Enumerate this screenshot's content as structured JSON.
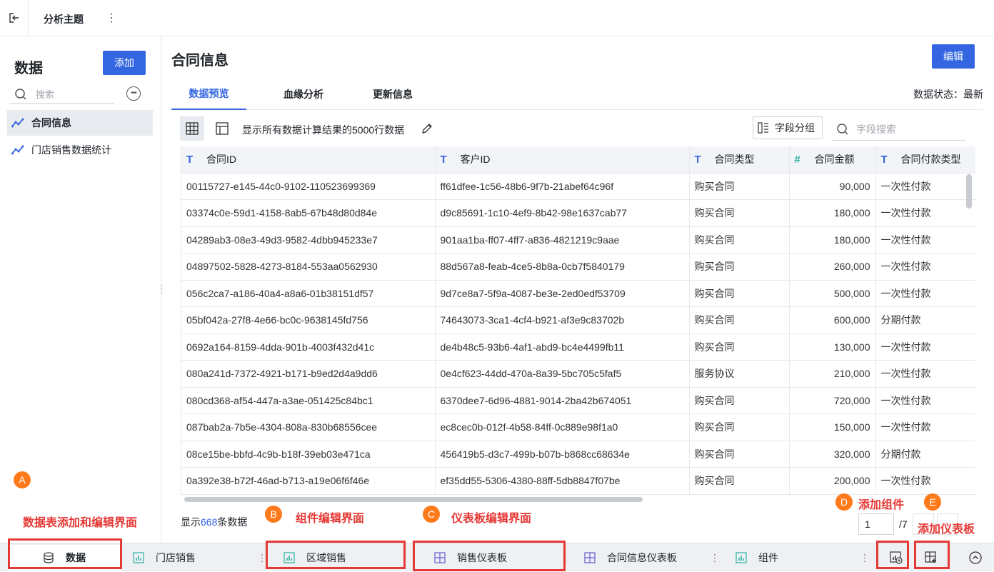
{
  "topbar": {
    "title": "分析主题"
  },
  "sidebar": {
    "title": "数据",
    "add_label": "添加",
    "search_placeholder": "搜索",
    "items": [
      {
        "label": "合同信息",
        "selected": true
      },
      {
        "label": "门店销售数据统计",
        "selected": false
      }
    ]
  },
  "main": {
    "title": "合同信息",
    "edit_label": "编辑",
    "tabs": [
      "数据预览",
      "血缘分析",
      "更新信息"
    ],
    "active_tab": "数据预览",
    "data_status": "数据状态：最新",
    "toolbar_text": "显示所有数据计算结果的5000行数据",
    "field_group_label": "字段分组",
    "field_search_placeholder": "字段搜索"
  },
  "table": {
    "columns": [
      {
        "name": "合同ID",
        "type": "T"
      },
      {
        "name": "客户ID",
        "type": "T"
      },
      {
        "name": "合同类型",
        "type": "T"
      },
      {
        "name": "合同金额",
        "type": "#"
      },
      {
        "name": "合同付款类型",
        "type": "T"
      }
    ],
    "rows": [
      [
        "00115727-e145-44c0-9102-110523699369",
        "ff61dfee-1c56-48b6-9f7b-21abef64c96f",
        "购买合同",
        "90,000",
        "一次性付款"
      ],
      [
        "03374c0e-59d1-4158-8ab5-67b48d80d84e",
        "d9c85691-1c10-4ef9-8b42-98e1637cab77",
        "购买合同",
        "180,000",
        "一次性付款"
      ],
      [
        "04289ab3-08e3-49d3-9582-4dbb945233e7",
        "901aa1ba-ff07-4ff7-a836-4821219c9aae",
        "购买合同",
        "180,000",
        "一次性付款"
      ],
      [
        "04897502-5828-4273-8184-553aa0562930",
        "88d567a8-feab-4ce5-8b8a-0cb7f5840179",
        "购买合同",
        "260,000",
        "一次性付款"
      ],
      [
        "056c2ca7-a186-40a4-a8a6-01b38151df57",
        "9d7ce8a7-5f9a-4087-be3e-2ed0edf53709",
        "购买合同",
        "500,000",
        "一次性付款"
      ],
      [
        "05bf042a-27f8-4e66-bc0c-9638145fd756",
        "74643073-3ca1-4cf4-b921-af3e9c83702b",
        "购买合同",
        "600,000",
        "分期付款"
      ],
      [
        "0692a164-8159-4dda-901b-4003f432d41c",
        "de4b48c5-93b6-4af1-abd9-bc4e4499fb11",
        "购买合同",
        "130,000",
        "一次性付款"
      ],
      [
        "080a241d-7372-4921-b171-b9ed2d4a9dd6",
        "0e4cf623-44dd-470a-8a39-5bc705c5faf5",
        "服务协议",
        "210,000",
        "一次性付款"
      ],
      [
        "080cd368-af54-447a-a3ae-051425c84bc1",
        "6370dee7-6d96-4881-9014-2ba42b674051",
        "购买合同",
        "720,000",
        "一次性付款"
      ],
      [
        "087bab2a-7b5e-4304-808a-830b68556cee",
        "ec8cec0b-012f-4b58-84ff-0c889e98f1a0",
        "购买合同",
        "150,000",
        "一次性付款"
      ],
      [
        "08ce15be-bbfd-4c9b-b18f-39eb03e471ca",
        "456419b5-d3c7-499b-b07b-b868cc68634e",
        "购买合同",
        "320,000",
        "分期付款"
      ],
      [
        "0a392e38-b72f-46ad-b713-a19e06f6f46e",
        "ef35dd55-5306-4380-88ff-5db8847f07be",
        "购买合同",
        "200,000",
        "一次性付款"
      ]
    ]
  },
  "footer": {
    "count_prefix": "显示",
    "count": "668",
    "count_suffix": "条数据",
    "page_current": "1",
    "page_total": "/7"
  },
  "bottom_tabs": [
    {
      "label": "数据",
      "icon": "database-icon"
    },
    {
      "label": "门店销售",
      "icon": "bar-chart-icon"
    },
    {
      "label": "区域销售",
      "icon": "bar-chart-icon"
    },
    {
      "label": "销售仪表板",
      "icon": "dashboard-icon"
    },
    {
      "label": "合同信息仪表板",
      "icon": "dashboard-icon"
    },
    {
      "label": "组件",
      "icon": "bar-chart-icon"
    }
  ],
  "annotations": {
    "a": {
      "badge": "A",
      "text": "数据表添加和编辑界面"
    },
    "b": {
      "badge": "B",
      "text": "组件编辑界面"
    },
    "c": {
      "badge": "C",
      "text": "仪表板编辑界面"
    },
    "d": {
      "badge": "D",
      "text": "添加组件"
    },
    "e": {
      "badge": "E",
      "text": "添加仪表板"
    }
  },
  "colors": {
    "accent": "#3366e0",
    "annotation": "#e53935",
    "badge": "#ff7a1a"
  }
}
